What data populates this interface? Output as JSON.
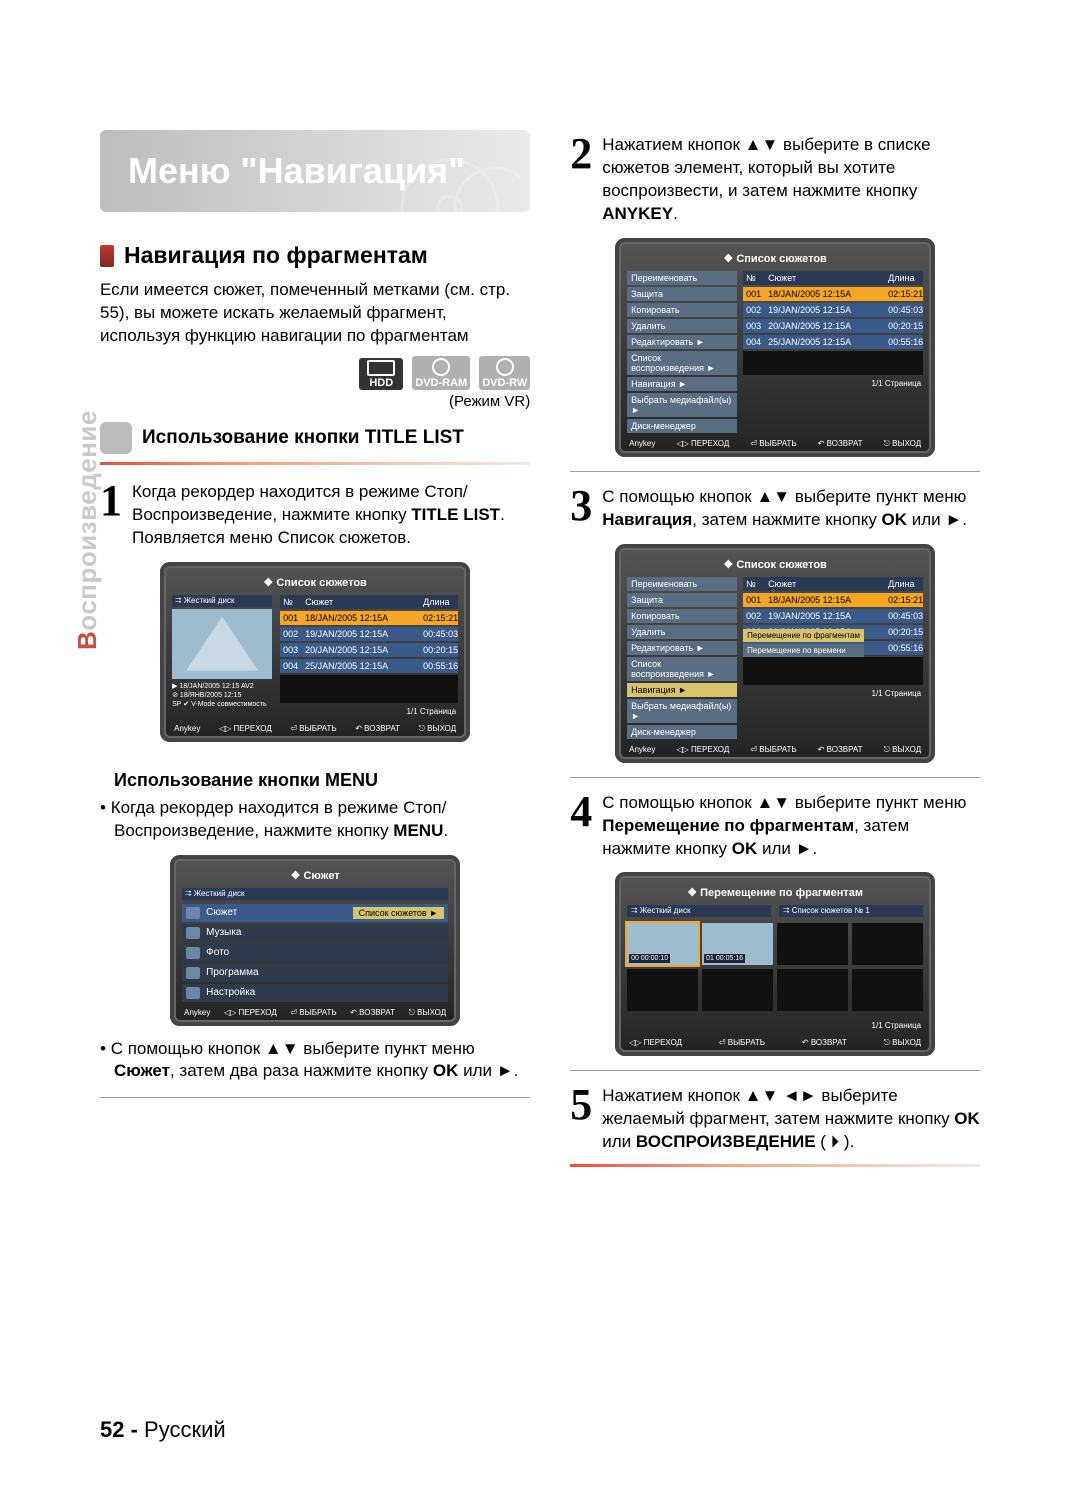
{
  "hero_title": "Меню \"Навигация\"",
  "side_label_accent": "В",
  "side_label_rest": "оспроизведение",
  "left": {
    "section_title": "Навигация по фрагментам",
    "intro": "Если имеется сюжет, помеченный метками (см. стр. 55), вы можете искать желаемый фрагмент, используя функцию навигации по фрагментам",
    "badges": {
      "hdd": "HDD",
      "dvdram": "DVD-RAM",
      "dvdrw": "DVD-RW"
    },
    "mode_note": "(Режим VR)",
    "subhead": "Использование кнопки TITLE LIST",
    "step1": "Когда рекордер находится в режиме Стоп/Воспроизведение, нажмите кнопку <b>TITLE LIST</b>.<br>Появляется меню Список сюжетов.",
    "screen1": {
      "title": "❖  Список сюжетов",
      "source": "⮆  Жесткий диск",
      "head": {
        "c1": "№",
        "c2": "Сюжет",
        "c3": "Длина"
      },
      "rows": [
        {
          "n": "001",
          "t": "18/JAN/2005 12:15A",
          "d": "02:15:21",
          "sel": true
        },
        {
          "n": "002",
          "t": "19/JAN/2005 12:15A",
          "d": "00:45:03"
        },
        {
          "n": "003",
          "t": "20/JAN/2005 12:15A",
          "d": "00:20:15"
        },
        {
          "n": "004",
          "t": "25/JAN/2005 12:15A",
          "d": "00:55:16"
        }
      ],
      "info_lines": [
        "▶ 18/JAN/2005 12:15 AV2",
        "⊘ 18/ЯНВ/2005 12:15",
        "SP ✔ V-Mode совместимость"
      ],
      "page": "1/1 Страница",
      "footer": [
        "Anykey",
        "◁▷ ПЕРЕХОД",
        "⏎ ВЫБРАТЬ",
        "↶ ВОЗВРАТ",
        "⎋ ВЫХОД"
      ]
    },
    "menu_sub": "Использование кнопки MENU",
    "menu_b1": "Когда рекордер находится в режиме Стоп/ Воспроизведение, нажмите кнопку <b>MENU</b>.",
    "screen2": {
      "title": "❖  Сюжет",
      "source": "⮆  Жесткий диск",
      "cats": [
        {
          "label": "Сюжет",
          "sub": "Список сюжетов  ►",
          "sel": true,
          "openSub": true
        },
        {
          "label": "Музыка"
        },
        {
          "label": "Фото"
        },
        {
          "label": "Программа"
        },
        {
          "label": "Настройка"
        }
      ],
      "footer": [
        "Anykey",
        "◁▷ ПЕРЕХОД",
        "⏎ ВЫБРАТЬ",
        "↶ ВОЗВРАТ",
        "⎋ ВЫХОД"
      ]
    },
    "menu_b2": "С помощью кнопок ▲▼ выберите пункт меню <b>Сюжет</b>, затем два раза нажмите кнопку <b>OK</b> или ►."
  },
  "right": {
    "step2": "Нажатием кнопок ▲▼ выберите в списке сюжетов элемент, который вы хотите воспроизвести, и затем нажмите кнопку <b>ANYKEY</b>.",
    "step3": "С помощью кнопок ▲▼ выберите пункт меню <b>Навигация</b>, затем нажмите кнопку <b>OK</b> или ►.",
    "step4": "С помощью кнопок ▲▼ выберите пункт меню <b>Перемещение по фрагментам</b>, затем нажмите кнопку <b>OK</b> или ►.",
    "step5": "Нажатием кнопок ▲▼ ◄► выберите желаемый фрагмент, затем нажмите кнопку <b>OK</b> или <b>ВОСПРОИЗВЕДЕНИЕ</b> ( ⏵ ).",
    "side_menu": [
      "Переименовать",
      "Защита",
      "Копировать",
      "Удалить",
      "Редактировать      ►",
      "Список воспроизведения ►",
      "Навигация              ►",
      "Выбрать медиафайл(ы) ►",
      "Диск-менеджер"
    ],
    "nav_sub": [
      "Перемещение по фрагментам",
      "Перемещение по времени"
    ],
    "scene_screen": {
      "title": "❖  Перемещение по фрагментам",
      "source": "⮆  Жесткий диск",
      "list_hdr": "⮆  Список сюжетов № 1",
      "cells": [
        {
          "lbl": "00  00:00:10",
          "filled": true,
          "sel": true
        },
        {
          "lbl": "01  00:05:16",
          "filled": true
        },
        {
          "lbl": ""
        },
        {
          "lbl": ""
        },
        {
          "lbl": ""
        },
        {
          "lbl": ""
        },
        {
          "lbl": ""
        },
        {
          "lbl": ""
        }
      ],
      "page": "1/1 Страница",
      "footer": [
        "◁▷ ПЕРЕХОД",
        "⏎ ВЫБРАТЬ",
        "↶ ВОЗВРАТ",
        "⎋ ВЫХОД"
      ]
    }
  },
  "footer_page": "52 -",
  "footer_lang": " Русский"
}
